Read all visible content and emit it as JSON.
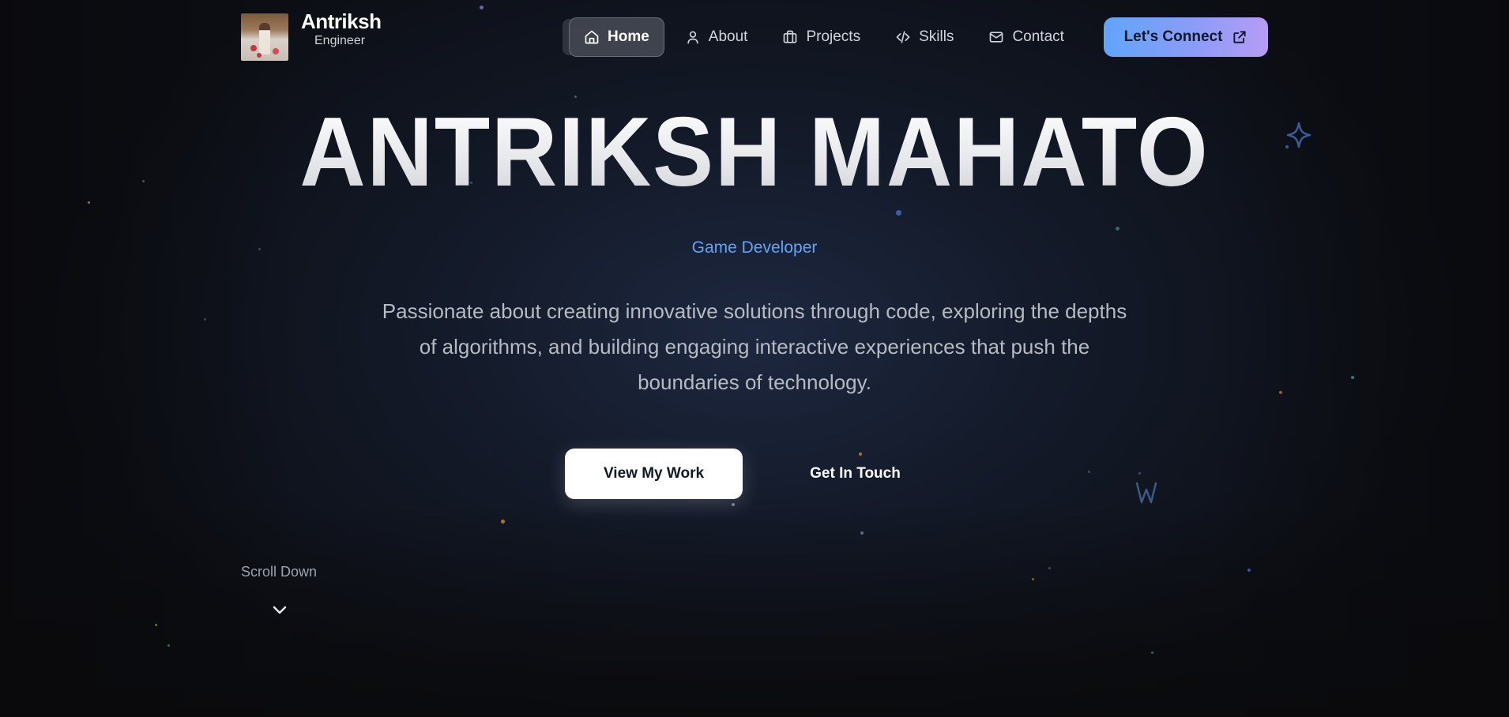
{
  "brand": {
    "name": "Antriksh",
    "role": "Engineer"
  },
  "nav": {
    "items": [
      {
        "label": "Home",
        "icon": "home-icon",
        "active": true
      },
      {
        "label": "About",
        "icon": "user-icon",
        "active": false
      },
      {
        "label": "Projects",
        "icon": "briefcase-icon",
        "active": false
      },
      {
        "label": "Skills",
        "icon": "code-icon",
        "active": false
      },
      {
        "label": "Contact",
        "icon": "mail-icon",
        "active": false
      }
    ],
    "cta_label": "Let's Connect",
    "cta_icon": "external-link-icon"
  },
  "hero": {
    "title": "ANTRIKSH MAHATO",
    "subtitle": "Game Developer",
    "tagline": "Passionate about creating innovative solutions through code, exploring the depths of algorithms, and building engaging interactive experiences that push the boundaries of technology.",
    "primary_button": "View My Work",
    "secondary_button": "Get In Touch"
  },
  "scroll": {
    "label": "Scroll Down",
    "icon": "chevron-down-icon"
  },
  "colors": {
    "accent_blue": "#60a5fa",
    "cta_gradient_start": "#60a5fa",
    "cta_gradient_end": "#b79cf5",
    "background": "#111722"
  }
}
